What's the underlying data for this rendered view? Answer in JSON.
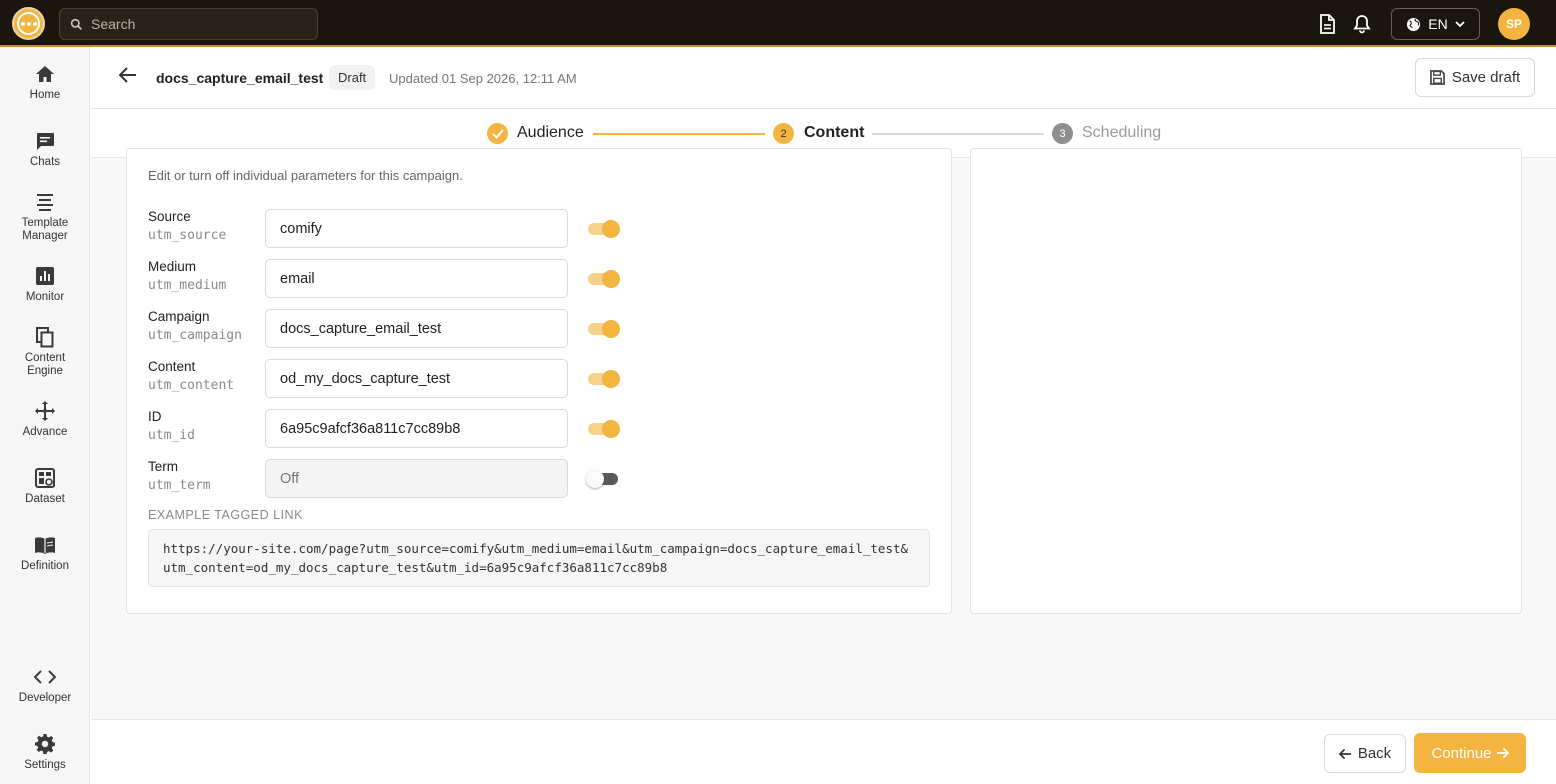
{
  "topbar": {
    "search_placeholder": "Search",
    "language": "EN",
    "avatar_initials": "SP"
  },
  "sidebar": {
    "items": [
      {
        "label": "Home",
        "icon": "home-icon"
      },
      {
        "label": "Chats",
        "icon": "chat-icon"
      },
      {
        "label": "Template Manager",
        "icon": "template-icon"
      },
      {
        "label": "Monitor",
        "icon": "monitor-icon"
      },
      {
        "label": "Content Engine",
        "icon": "copy-icon"
      },
      {
        "label": "Advance",
        "icon": "move-icon"
      },
      {
        "label": "Dataset",
        "icon": "dataset-icon"
      },
      {
        "label": "Definition",
        "icon": "book-icon"
      },
      {
        "label": "Developer",
        "icon": "code-icon"
      },
      {
        "label": "Settings",
        "icon": "gear-icon"
      }
    ]
  },
  "header": {
    "campaign_name": "docs_capture_email_test",
    "status": "Draft",
    "updated": "Updated 01 Sep 2026, 12:11 AM",
    "save_label": "Save draft"
  },
  "stepper": {
    "steps": [
      {
        "label": "Audience",
        "state": "done",
        "number": ""
      },
      {
        "label": "Content",
        "state": "active",
        "number": "2"
      },
      {
        "label": "Scheduling",
        "state": "pending",
        "number": "3"
      }
    ]
  },
  "utm": {
    "intro": "Edit or turn off individual parameters for this campaign.",
    "params": [
      {
        "label": "Source",
        "key": "utm_source",
        "value": "comify",
        "enabled": true,
        "placeholder": ""
      },
      {
        "label": "Medium",
        "key": "utm_medium",
        "value": "email",
        "enabled": true,
        "placeholder": ""
      },
      {
        "label": "Campaign",
        "key": "utm_campaign",
        "value": "docs_capture_email_test",
        "enabled": true,
        "placeholder": ""
      },
      {
        "label": "Content",
        "key": "utm_content",
        "value": "od_my_docs_capture_test",
        "enabled": true,
        "placeholder": ""
      },
      {
        "label": "ID",
        "key": "utm_id",
        "value": "6a95c9afcf36a811c7cc89b8",
        "enabled": true,
        "placeholder": ""
      },
      {
        "label": "Term",
        "key": "utm_term",
        "value": "",
        "enabled": false,
        "placeholder": "Off"
      }
    ],
    "example_label": "EXAMPLE TAGGED LINK",
    "example_link": "https://your-site.com/page?utm_source=comify&utm_medium=email&utm_campaign=docs_capture_email_test&utm_content=od_my_docs_capture_test&utm_id=6a95c9afcf36a811c7cc89b8"
  },
  "footer": {
    "back_label": "Back",
    "continue_label": "Continue"
  },
  "colors": {
    "accent": "#f3b53f",
    "topbar": "#1b1510",
    "toggle_off": "#555555"
  }
}
